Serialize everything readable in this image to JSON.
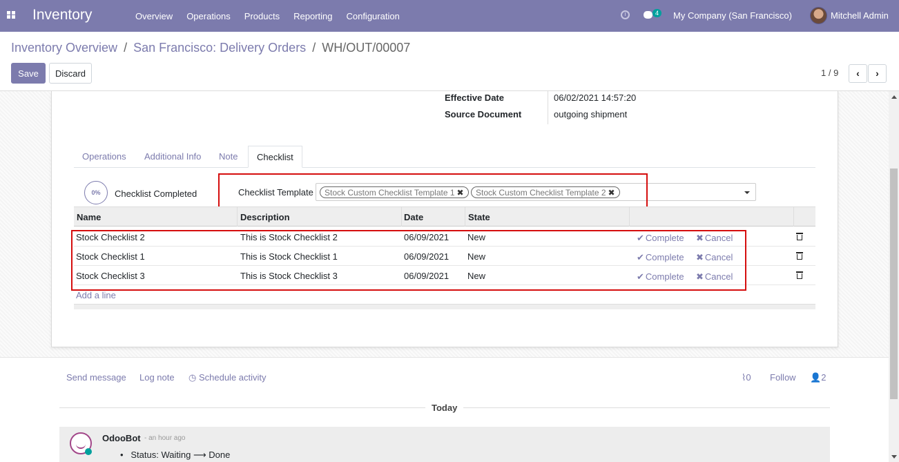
{
  "app": {
    "title": "Inventory"
  },
  "menu": [
    "Overview",
    "Operations",
    "Products",
    "Reporting",
    "Configuration"
  ],
  "systray": {
    "chat_count": "4",
    "company": "My Company (San Francisco)",
    "user": "Mitchell Admin"
  },
  "breadcrumb": {
    "first": "Inventory Overview",
    "second": "San Francisco: Delivery Orders",
    "current": "WH/OUT/00007",
    "sep": "/"
  },
  "buttons": {
    "save": "Save",
    "discard": "Discard"
  },
  "pager": {
    "value": "1 / 9",
    "prev": "‹",
    "next": "›"
  },
  "fields": {
    "effective_date_label": "Effective Date",
    "effective_date": "06/02/2021 14:57:20",
    "source_document_label": "Source Document",
    "source_document": "outgoing shipment"
  },
  "tabs": [
    "Operations",
    "Additional Info",
    "Note",
    "Checklist"
  ],
  "checklist": {
    "progress": "0%",
    "completed_label": "Checklist Completed",
    "template_label": "Checklist Template",
    "templates": [
      "Stock Custom Checklist Template 1",
      "Stock Custom Checklist Template 2"
    ],
    "columns": [
      "Name",
      "Description",
      "Date",
      "State"
    ],
    "rows": [
      {
        "name": "Stock Checklist 2",
        "description": "This is Stock Checklist 2",
        "date": "06/09/2021",
        "state": "New"
      },
      {
        "name": "Stock Checklist 1",
        "description": "This is Stock Checklist 1",
        "date": "06/09/2021",
        "state": "New"
      },
      {
        "name": "Stock Checklist 3",
        "description": "This is Stock Checklist 3",
        "date": "06/09/2021",
        "state": "New"
      }
    ],
    "complete_label": "Complete",
    "cancel_label": "Cancel",
    "add_line": "Add a line"
  },
  "chatter": {
    "send_message": "Send message",
    "log_note": "Log note",
    "schedule_activity": "Schedule activity",
    "attachments": "0",
    "follow": "Follow",
    "followers": "2",
    "today": "Today",
    "author": "OdooBot",
    "time": "- an hour ago",
    "status_label": "Status:",
    "status_from": "Waiting",
    "status_to": "Done"
  },
  "colors": {
    "brand": "#7c7bad",
    "highlight": "#d50d0d"
  }
}
